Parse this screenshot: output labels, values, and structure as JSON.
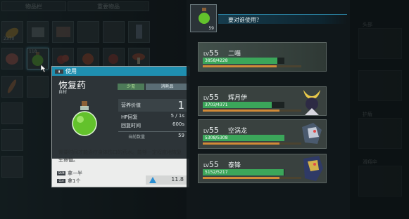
{
  "inventory": {
    "tabs": [
      "物品栏",
      "重要物品"
    ],
    "slots": [
      {
        "count": "2370",
        "badge": ""
      },
      {
        "count": "",
        "badge": ""
      },
      {
        "count": "",
        "badge": ""
      },
      {
        "count": "",
        "badge": ""
      },
      {
        "count": "",
        "badge": ""
      },
      {
        "count": "",
        "badge": ""
      },
      {
        "count": "",
        "badge": ""
      },
      {
        "count": "118",
        "badge": ""
      },
      {
        "count": "",
        "badge": ""
      },
      {
        "count": "",
        "badge": ""
      },
      {
        "count": "",
        "badge": ""
      },
      {
        "count": "",
        "badge": ""
      }
    ]
  },
  "background_panel": {
    "labels": [
      "头部",
      "护盾",
      "滑翔伞"
    ]
  },
  "tooltip": {
    "header": "使用",
    "item_name": "恢复药",
    "category": "自材",
    "rarity": "少见",
    "usage": "消耗品",
    "stats": {
      "nutrition_label": "营养价值",
      "nutrition_value": "1",
      "hp_label": "HP回复",
      "hp_value": "5 / 1s",
      "time_label": "回复时间",
      "time_value": "600s",
      "held_label": "当前数量",
      "held_value": "59"
    },
    "description": "需要时间才能治疗身体伤口的药水。能够一定程度地恢复生命值。",
    "controls": [
      {
        "key": "Shift",
        "label": "拿一半"
      },
      {
        "key": "Ctrl",
        "label": "拿1个"
      }
    ],
    "weight": "11.8"
  },
  "target": {
    "question": "要对谁使用？",
    "item_count": "59",
    "pals": [
      {
        "level_prefix": "LV",
        "level": "55",
        "name": "二喵",
        "hp_text": "3858/4228",
        "hp": 3858,
        "hp_max": 4228,
        "xp": 0.75
      },
      {
        "level_prefix": "LV",
        "level": "55",
        "name": "辉月伊",
        "hp_text": "3703/4371",
        "hp": 3703,
        "hp_max": 4371,
        "xp": 0.78
      },
      {
        "level_prefix": "LV",
        "level": "55",
        "name": "空涡龙",
        "hp_text": "5308/5308",
        "hp": 5308,
        "hp_max": 5308,
        "xp": 0.78
      },
      {
        "level_prefix": "LV",
        "level": "55",
        "name": "泰锋",
        "hp_text": "5152/5217",
        "hp": 5152,
        "hp_max": 5217,
        "xp": 0.78
      }
    ]
  },
  "colors": {
    "hp": "#3ba65a",
    "xp": "#d28a37",
    "accent": "#1f8fb0"
  }
}
